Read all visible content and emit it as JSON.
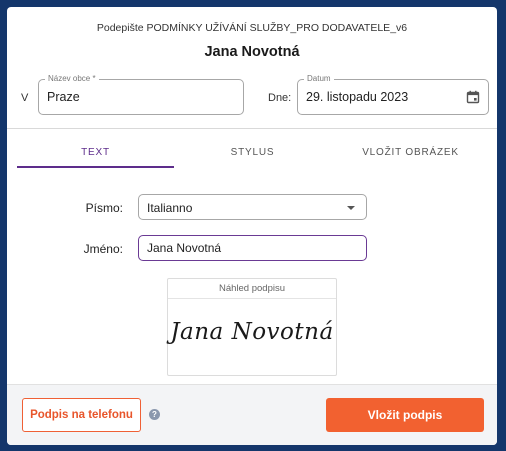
{
  "header": {
    "document_title": "Podepište PODMÍNKY UŽÍVÁNÍ SLUŽBY_PRO DODAVATELE_v6",
    "signer_name": "Jana Novotná"
  },
  "place": {
    "prefix_label": "V",
    "legend": "Název obce *",
    "value": "Praze"
  },
  "date": {
    "prefix_label": "Dne:",
    "legend": "Datum",
    "value": "29. listopadu 2023",
    "icon": "calendar-icon"
  },
  "tabs": [
    {
      "label": "TEXT",
      "active": true
    },
    {
      "label": "STYLUS",
      "active": false
    },
    {
      "label": "VLOŽIT OBRÁZEK",
      "active": false
    }
  ],
  "font_select": {
    "label": "Písmo:",
    "value": "Italianno"
  },
  "name_field": {
    "label": "Jméno:",
    "value": "Jana Novotná"
  },
  "preview": {
    "header": "Náhled podpisu",
    "signature_text": "Jana Novotná"
  },
  "footer": {
    "phone_button": "Podpis na telefonu",
    "help_icon": "question-circle-icon",
    "help_glyph": "?",
    "insert_button": "Vložit podpis"
  },
  "colors": {
    "accent_purple": "#5d2d8b",
    "accent_orange": "#f26130",
    "backdrop": "#14366b"
  }
}
